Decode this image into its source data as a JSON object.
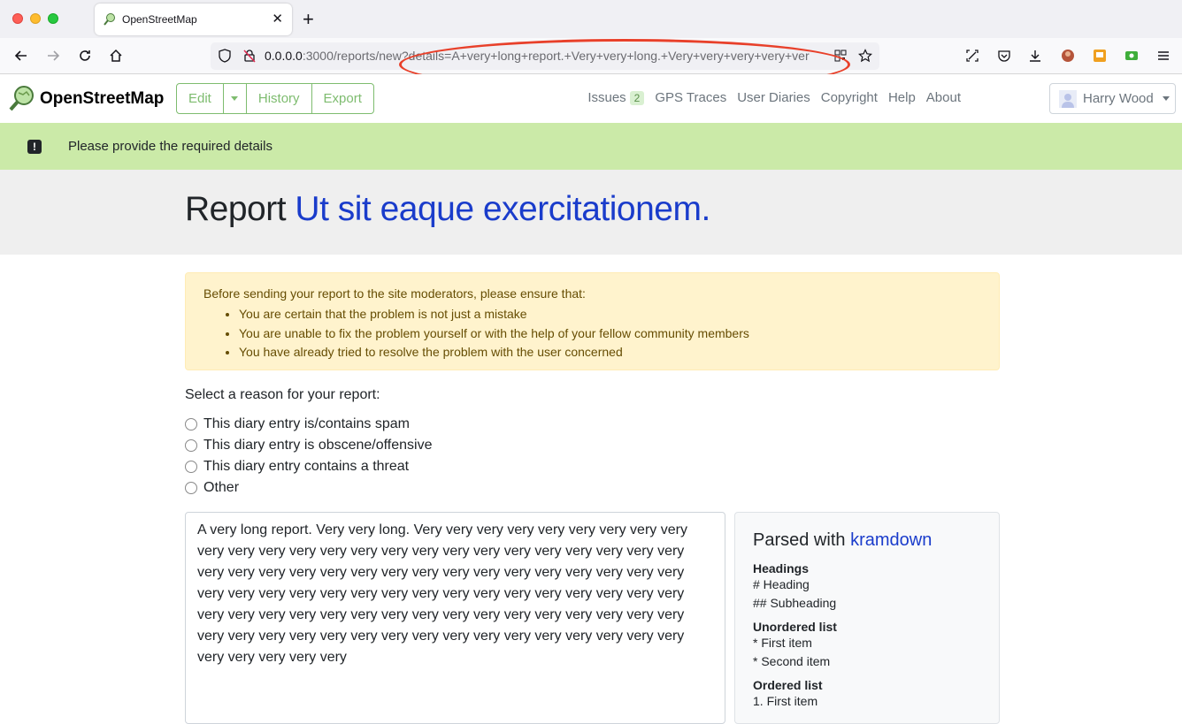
{
  "browser": {
    "tab_title": "OpenStreetMap",
    "url_host": "0.0.0.0",
    "url_rest": ":3000/reports/new?details=A+very+long+report.+Very+very+long.+Very+very+very+very+ver"
  },
  "osm": {
    "brand": "OpenStreetMap",
    "edit_buttons": [
      "Edit",
      "History",
      "Export"
    ],
    "nav_links": [
      "Issues",
      "GPS Traces",
      "User Diaries",
      "Copyright",
      "Help",
      "About"
    ],
    "issues_count": "2",
    "user_name": "Harry Wood"
  },
  "flash": {
    "message": "Please provide the required details"
  },
  "page": {
    "title_prefix": "Report",
    "title_link": "Ut sit eaque exercitationem."
  },
  "warning": {
    "intro": "Before sending your report to the site moderators, please ensure that:",
    "items": [
      "You are certain that the problem is not just a mistake",
      "You are unable to fix the problem yourself or with the help of your fellow community members",
      "You have already tried to resolve the problem with the user concerned"
    ]
  },
  "reasons": {
    "label": "Select a reason for your report:",
    "options": [
      "This diary entry is/contains spam",
      "This diary entry is obscene/offensive",
      "This diary entry contains a threat",
      "Other"
    ]
  },
  "details_text": "A very long report. Very very long. Very very very very very very very very very very very very very very very very very very very very very very very very very very very very very very very very very very very very very very very very very very very very very very very very very very very very very very very very very very very very very very very very very very very very very very very very very very very very very very very very very very very very very very very very very very very very very very",
  "help": {
    "title_prefix": "Parsed with",
    "title_link": "kramdown",
    "sections": [
      {
        "heading": "Headings",
        "lines": [
          "# Heading",
          "## Subheading"
        ]
      },
      {
        "heading": "Unordered list",
        "lines": [
          "* First item",
          "* Second item"
        ]
      },
      {
        "heading": "Ordered list",
        "lines": [
          "1. First item"
        ]
      }
    ]
  },
  "colors": {
    "osm_green": "#7ebc6f",
    "flash_bg": "#cbeaa8",
    "link_blue": "#1a3ccb",
    "annotation": "#e8402a"
  }
}
